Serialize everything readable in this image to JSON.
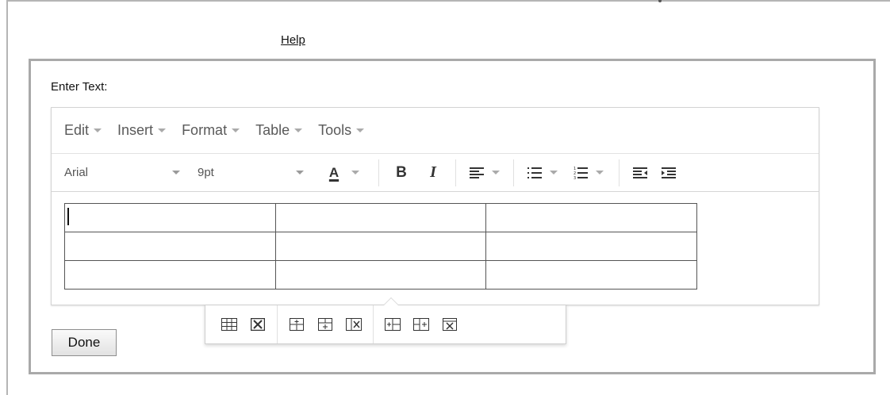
{
  "help_link": "Help",
  "enter_label": "Enter Text:",
  "menus": [
    "Edit",
    "Insert",
    "Format",
    "Table",
    "Tools"
  ],
  "toolbar": {
    "font_family": "Arial",
    "font_size": "9pt",
    "text_color_glyph": "A",
    "bold_glyph": "B",
    "italic_glyph": "I"
  },
  "table": {
    "rows": 3,
    "cols": 3
  },
  "done_label": "Done",
  "icons": {
    "toolbar": [
      "text-color-icon",
      "bold-icon",
      "italic-icon",
      "align-left-icon",
      "bullet-list-icon",
      "numbered-list-icon",
      "outdent-icon",
      "indent-icon"
    ],
    "context": [
      "table-props-icon",
      "delete-table-icon",
      "insert-row-before-icon",
      "insert-row-after-icon",
      "delete-row-icon",
      "insert-col-before-icon",
      "insert-col-after-icon",
      "delete-col-icon"
    ]
  },
  "colors": {
    "border": "#a9a9a9",
    "menu_text": "#5a5a5a",
    "caret": "#aaaaaa"
  }
}
